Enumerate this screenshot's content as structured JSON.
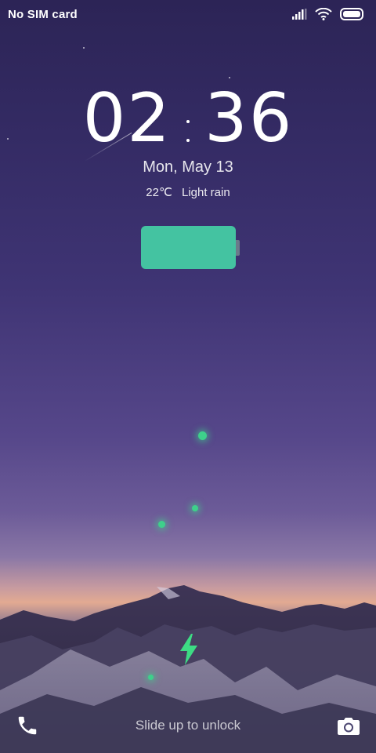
{
  "status_bar": {
    "carrier": "No SIM card",
    "icons": [
      "signal-icon",
      "wifi-icon",
      "battery-icon"
    ]
  },
  "lock_screen": {
    "hours": "02",
    "minutes": "36",
    "date": "Mon, May 13",
    "weather": {
      "temperature": "22℃",
      "condition": "Light rain"
    },
    "charging_indicator": {
      "color": "#44c3a1",
      "bolt_color": "#3ddc84"
    }
  },
  "bottom_bar": {
    "unlock_hint": "Slide up to unlock",
    "left_shortcut": "phone-icon",
    "right_shortcut": "camera-icon"
  }
}
